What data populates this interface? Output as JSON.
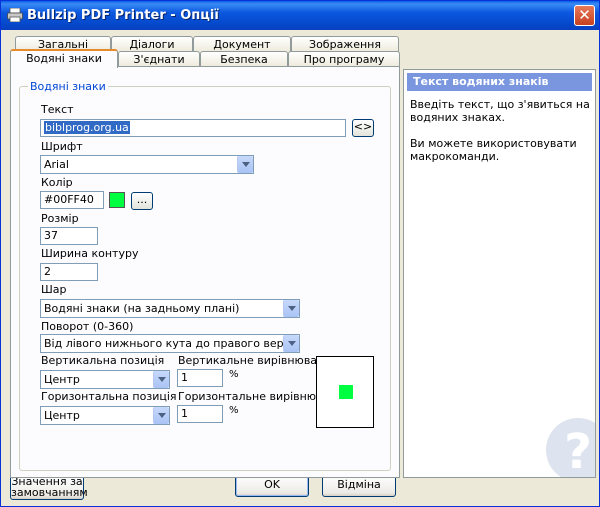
{
  "window": {
    "title": "Bullzip PDF Printer - Опції",
    "close_glyph": "✕"
  },
  "tabs_row1": [
    "Загальні",
    "Діалоги",
    "Документ",
    "Зображення"
  ],
  "tabs_row2": [
    "Водяні знаки",
    "З'єднати",
    "Безпека",
    "Про програму"
  ],
  "active_tab": "Водяні знаки",
  "watermark": {
    "group_title": "Водяні знаки",
    "text_label": "Текст",
    "text_value": "biblprog.org.ua",
    "macro_button": "<>",
    "font_label": "Шрифт",
    "font_value": "Arial",
    "color_label": "Колір",
    "color_value": "#00FF40",
    "color_swatch": "#00ff40",
    "color_browse": "...",
    "size_label": "Розмір",
    "size_value": "37",
    "outline_label": "Ширина контуру",
    "outline_value": "2",
    "layer_label": "Шар",
    "layer_value": "Водяні знаки (на задньому плані)",
    "rotation_label": "Поворот (0-360)",
    "rotation_value": "Від лівого нижнього кута до правого верхнього",
    "vpos_label": "Вертикальна позиція",
    "vpos_value": "Центр",
    "valign_label": "Вертикальне вирівнювання",
    "valign_value": "1",
    "valign_unit": "%",
    "hpos_label": "Горизонтальна позиція",
    "hpos_value": "Центр",
    "halign_label": "Горизонтальне вирівнювання",
    "halign_value": "1",
    "halign_unit": "%"
  },
  "help": {
    "title": "Текст водяних знаків",
    "paragraph1": "Введіть текст, що з'явиться на водяних знаках.",
    "paragraph2": "Ви можете використовувати макрокоманди."
  },
  "buttons": {
    "defaults": "Значення за замовчанням",
    "ok": "OK",
    "cancel": "Відміна"
  }
}
